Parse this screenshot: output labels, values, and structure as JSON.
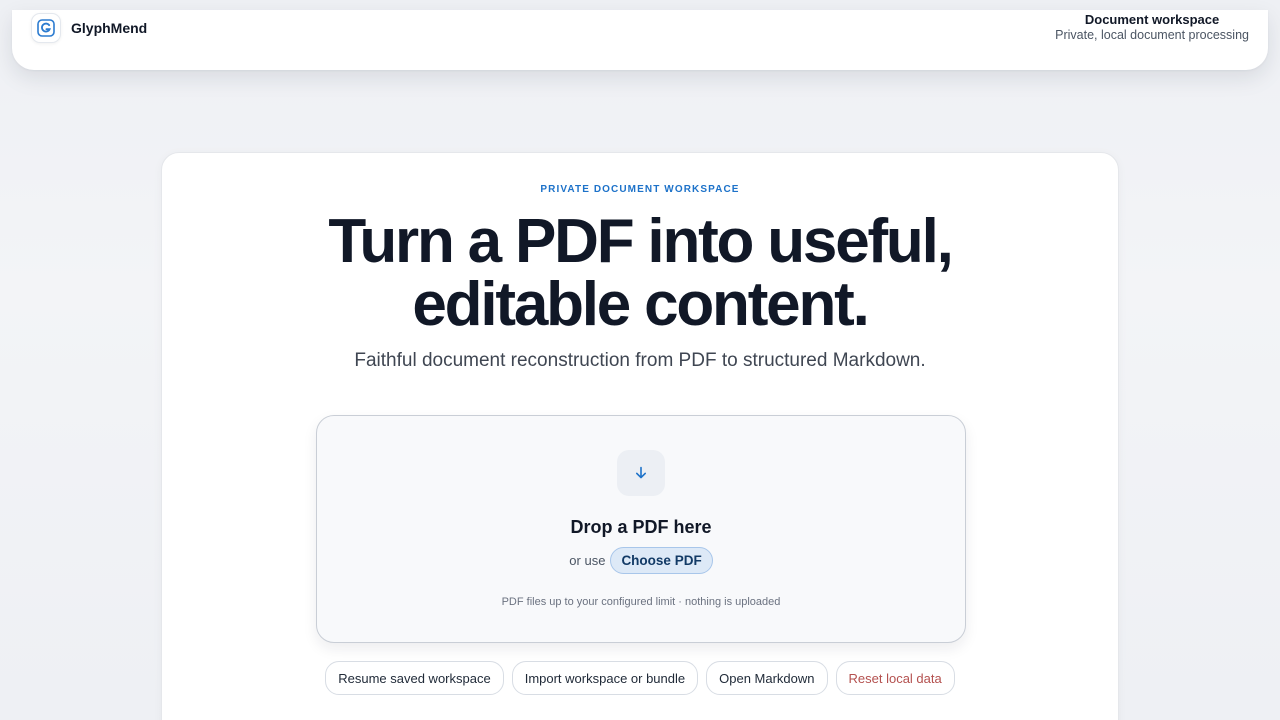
{
  "app": {
    "name": "GlyphMend",
    "logo_icon": "glyph-g-icon"
  },
  "header": {
    "workspace_title": "Document workspace",
    "workspace_subtitle": "Private, local document processing"
  },
  "hero": {
    "eyebrow": "PRIVATE DOCUMENT WORKSPACE",
    "headline_line1": "Turn a PDF into useful,",
    "headline_line2": "editable content.",
    "subheadline": "Faithful document reconstruction from PDF to structured Markdown."
  },
  "dropzone": {
    "icon": "arrow-down-icon",
    "title": "Drop a PDF here",
    "or_text": "or use",
    "choose_label": "Choose PDF",
    "note": "PDF files up to your configured limit · nothing is uploaded"
  },
  "actions": {
    "resume": "Resume saved workspace",
    "import": "Import workspace or bundle",
    "open_markdown": "Open Markdown",
    "reset": "Reset local data"
  },
  "colors": {
    "accent": "#1d72c9",
    "danger": "#b4514f",
    "choose_bg": "#dde9f7"
  }
}
